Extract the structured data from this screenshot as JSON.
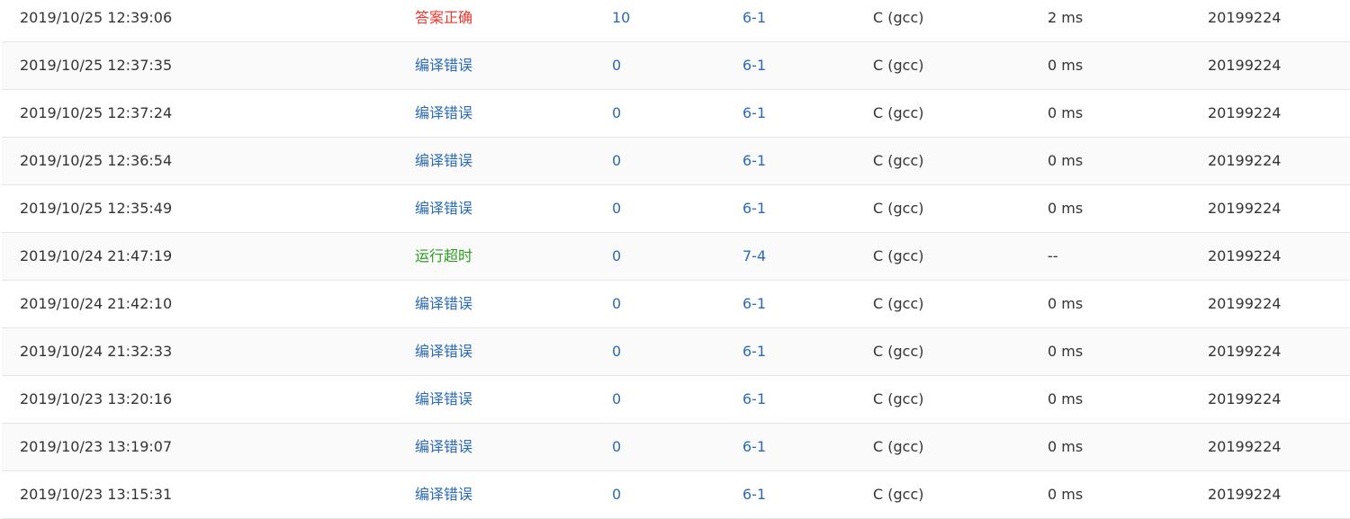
{
  "submissions": {
    "status_colors": {
      "accepted": "#e8372b",
      "compile_error": "#2a6ab8",
      "time_limit": "#2c9c21"
    },
    "rows": [
      {
        "time": "2019/10/25 12:39:06",
        "status": "答案正确",
        "status_kind": "accepted",
        "score": "10",
        "problem": "6-1",
        "compiler": "C (gcc)",
        "runtime": "2 ms",
        "user": "20199224"
      },
      {
        "time": "2019/10/25 12:37:35",
        "status": "编译错误",
        "status_kind": "compile_error",
        "score": "0",
        "problem": "6-1",
        "compiler": "C (gcc)",
        "runtime": "0 ms",
        "user": "20199224"
      },
      {
        "time": "2019/10/25 12:37:24",
        "status": "编译错误",
        "status_kind": "compile_error",
        "score": "0",
        "problem": "6-1",
        "compiler": "C (gcc)",
        "runtime": "0 ms",
        "user": "20199224"
      },
      {
        "time": "2019/10/25 12:36:54",
        "status": "编译错误",
        "status_kind": "compile_error",
        "score": "0",
        "problem": "6-1",
        "compiler": "C (gcc)",
        "runtime": "0 ms",
        "user": "20199224"
      },
      {
        "time": "2019/10/25 12:35:49",
        "status": "编译错误",
        "status_kind": "compile_error",
        "score": "0",
        "problem": "6-1",
        "compiler": "C (gcc)",
        "runtime": "0 ms",
        "user": "20199224"
      },
      {
        "time": "2019/10/24 21:47:19",
        "status": "运行超时",
        "status_kind": "time_limit",
        "score": "0",
        "problem": "7-4",
        "compiler": "C (gcc)",
        "runtime": "--",
        "user": "20199224"
      },
      {
        "time": "2019/10/24 21:42:10",
        "status": "编译错误",
        "status_kind": "compile_error",
        "score": "0",
        "problem": "6-1",
        "compiler": "C (gcc)",
        "runtime": "0 ms",
        "user": "20199224"
      },
      {
        "time": "2019/10/24 21:32:33",
        "status": "编译错误",
        "status_kind": "compile_error",
        "score": "0",
        "problem": "6-1",
        "compiler": "C (gcc)",
        "runtime": "0 ms",
        "user": "20199224"
      },
      {
        "time": "2019/10/23 13:20:16",
        "status": "编译错误",
        "status_kind": "compile_error",
        "score": "0",
        "problem": "6-1",
        "compiler": "C (gcc)",
        "runtime": "0 ms",
        "user": "20199224"
      },
      {
        "time": "2019/10/23 13:19:07",
        "status": "编译错误",
        "status_kind": "compile_error",
        "score": "0",
        "problem": "6-1",
        "compiler": "C (gcc)",
        "runtime": "0 ms",
        "user": "20199224"
      },
      {
        "time": "2019/10/23 13:15:31",
        "status": "编译错误",
        "status_kind": "compile_error",
        "score": "0",
        "problem": "6-1",
        "compiler": "C (gcc)",
        "runtime": "0 ms",
        "user": "20199224"
      }
    ]
  }
}
